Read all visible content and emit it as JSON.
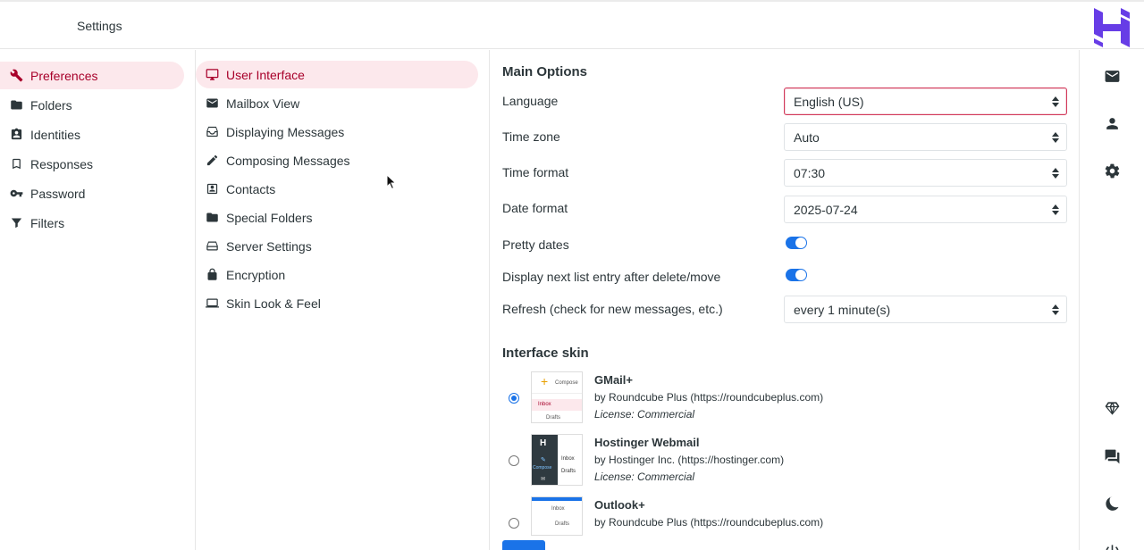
{
  "header": {
    "title": "Settings"
  },
  "sections": [
    {
      "label": "Preferences",
      "icon": "wrench-icon",
      "active": true
    },
    {
      "label": "Folders",
      "icon": "folder-icon"
    },
    {
      "label": "Identities",
      "icon": "id-card-icon"
    },
    {
      "label": "Responses",
      "icon": "bookmark-icon"
    },
    {
      "label": "Password",
      "icon": "key-icon"
    },
    {
      "label": "Filters",
      "icon": "filter-icon"
    }
  ],
  "preferences": [
    {
      "label": "User Interface",
      "icon": "monitor-icon",
      "active": true
    },
    {
      "label": "Mailbox View",
      "icon": "envelope-icon"
    },
    {
      "label": "Displaying Messages",
      "icon": "inbox-icon"
    },
    {
      "label": "Composing Messages",
      "icon": "pencil-icon"
    },
    {
      "label": "Contacts",
      "icon": "contact-card-icon"
    },
    {
      "label": "Special Folders",
      "icon": "folder-icon"
    },
    {
      "label": "Server Settings",
      "icon": "server-icon"
    },
    {
      "label": "Encryption",
      "icon": "lock-icon"
    },
    {
      "label": "Skin Look & Feel",
      "icon": "laptop-icon"
    }
  ],
  "main_options": {
    "heading": "Main Options",
    "language": {
      "label": "Language",
      "value": "English (US)"
    },
    "timezone": {
      "label": "Time zone",
      "value": "Auto"
    },
    "time_format": {
      "label": "Time format",
      "value": "07:30"
    },
    "date_format": {
      "label": "Date format",
      "value": "2025-07-24"
    },
    "pretty_dates": {
      "label": "Pretty dates",
      "enabled": true
    },
    "next_entry": {
      "label": "Display next list entry after delete/move",
      "enabled": true
    },
    "refresh": {
      "label": "Refresh (check for new messages, etc.)",
      "value": "every 1 minute(s)"
    }
  },
  "interface_skin": {
    "heading": "Interface skin",
    "skins": [
      {
        "name": "GMail+",
        "by": "by Roundcube Plus (https://roundcubeplus.com)",
        "license": "License: Commercial",
        "selected": true,
        "thumb": {
          "compose": "Compose",
          "inbox": "Inbox",
          "drafts": "Drafts"
        }
      },
      {
        "name": "Hostinger Webmail",
        "by": "by Hostinger Inc. (https://hostinger.com)",
        "license": "License: Commercial",
        "selected": false,
        "thumb": {
          "compose": "Compose",
          "inbox": "Inbox",
          "drafts": "Drafts"
        }
      },
      {
        "name": "Outlook+",
        "by": "by Roundcube Plus (https://roundcubeplus.com)",
        "selected": false,
        "thumb": {
          "inbox": "Inbox",
          "drafts": "Drafts"
        }
      }
    ]
  },
  "rail": [
    {
      "icon": "mail-icon"
    },
    {
      "icon": "contacts-icon"
    },
    {
      "icon": "settings-gear-icon"
    },
    {
      "icon": "diamond-icon"
    },
    {
      "icon": "chat-icon"
    },
    {
      "icon": "moon-icon"
    },
    {
      "icon": "power-icon"
    }
  ],
  "colors": {
    "accent": "#a8002a",
    "active_bg": "#fce8ec",
    "primary": "#1a73e8",
    "brand": "#673de6"
  }
}
